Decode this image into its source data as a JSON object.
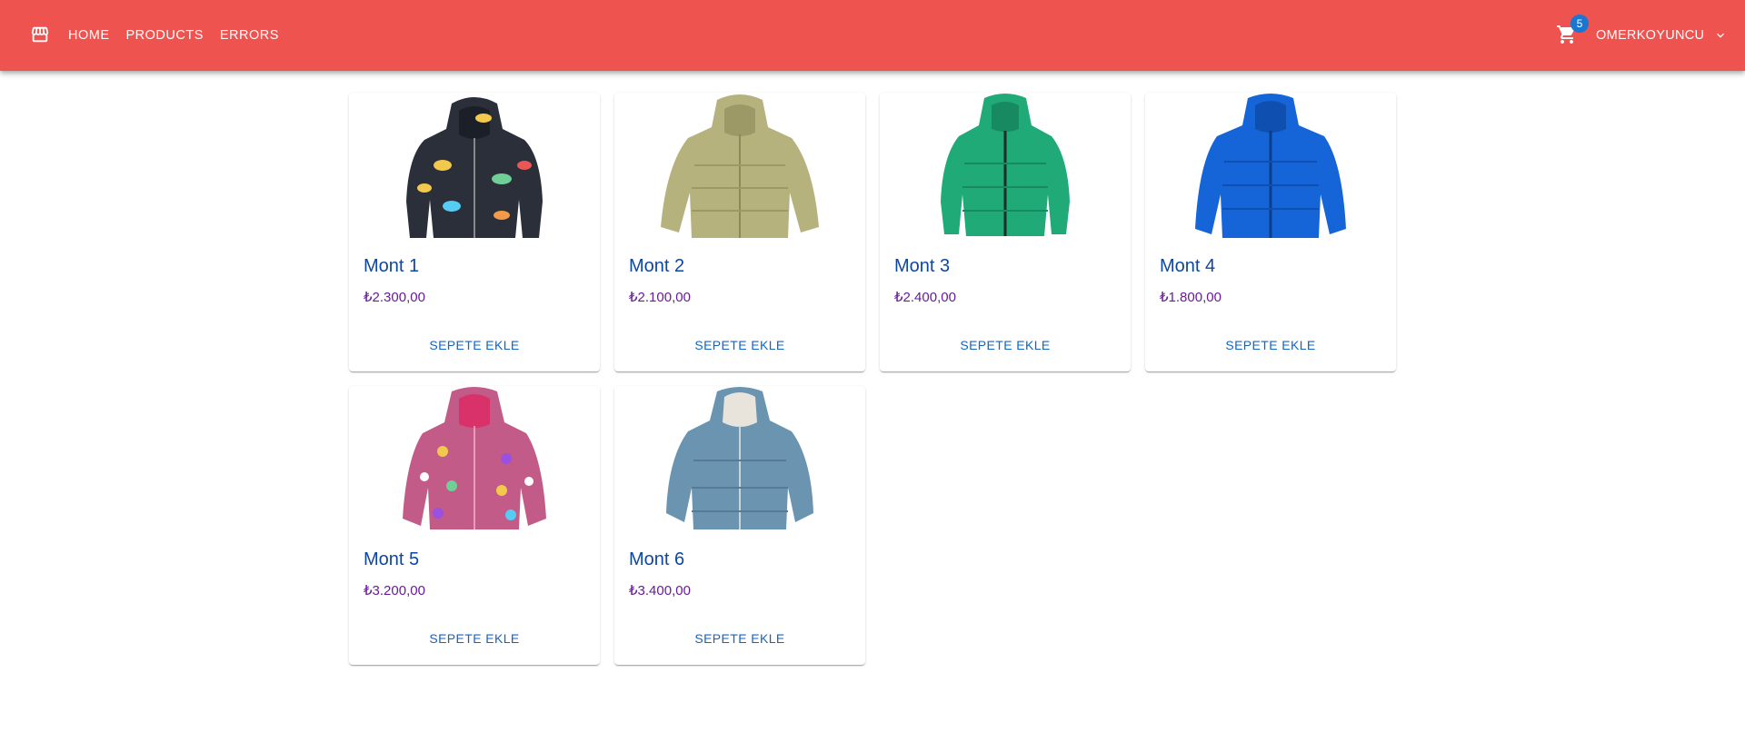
{
  "nav": {
    "store_icon": "storefront-icon",
    "links": [
      {
        "label": "HOME"
      },
      {
        "label": "PRODUCTS"
      },
      {
        "label": "ERRORS"
      }
    ]
  },
  "cart": {
    "icon": "shopping-cart-icon",
    "count": "5"
  },
  "user": {
    "name": "OMERKOYUNCU",
    "icon": "chevron-down-icon"
  },
  "colors": {
    "appbar": "#ef5350",
    "title": "#0d47a1",
    "price": "#6a1b9a",
    "action": "#1565c0",
    "badge": "#1976d2"
  },
  "products": [
    {
      "title": "Mont 1",
      "price": "₺2.300,00",
      "action": "SEPETE EKLE",
      "image": "dinosaur-print-puffer-jacket",
      "color": "#2a2f3a"
    },
    {
      "title": "Mont 2",
      "price": "₺2.100,00",
      "action": "SEPETE EKLE",
      "image": "khaki-puffer-jacket",
      "color": "#b5b27e"
    },
    {
      "title": "Mont 3",
      "price": "₺2.400,00",
      "action": "SEPETE EKLE",
      "image": "green-puffer-jacket",
      "color": "#1faa78"
    },
    {
      "title": "Mont 4",
      "price": "₺1.800,00",
      "action": "SEPETE EKLE",
      "image": "blue-puffer-jacket",
      "color": "#1565d8"
    },
    {
      "title": "Mont 5",
      "price": "₺3.200,00",
      "action": "SEPETE EKLE",
      "image": "floral-puffer-jacket",
      "color": "#c25b88"
    },
    {
      "title": "Mont 6",
      "price": "₺3.400,00",
      "action": "SEPETE EKLE",
      "image": "steel-blue-puffer-jacket",
      "color": "#6a94b0"
    }
  ]
}
